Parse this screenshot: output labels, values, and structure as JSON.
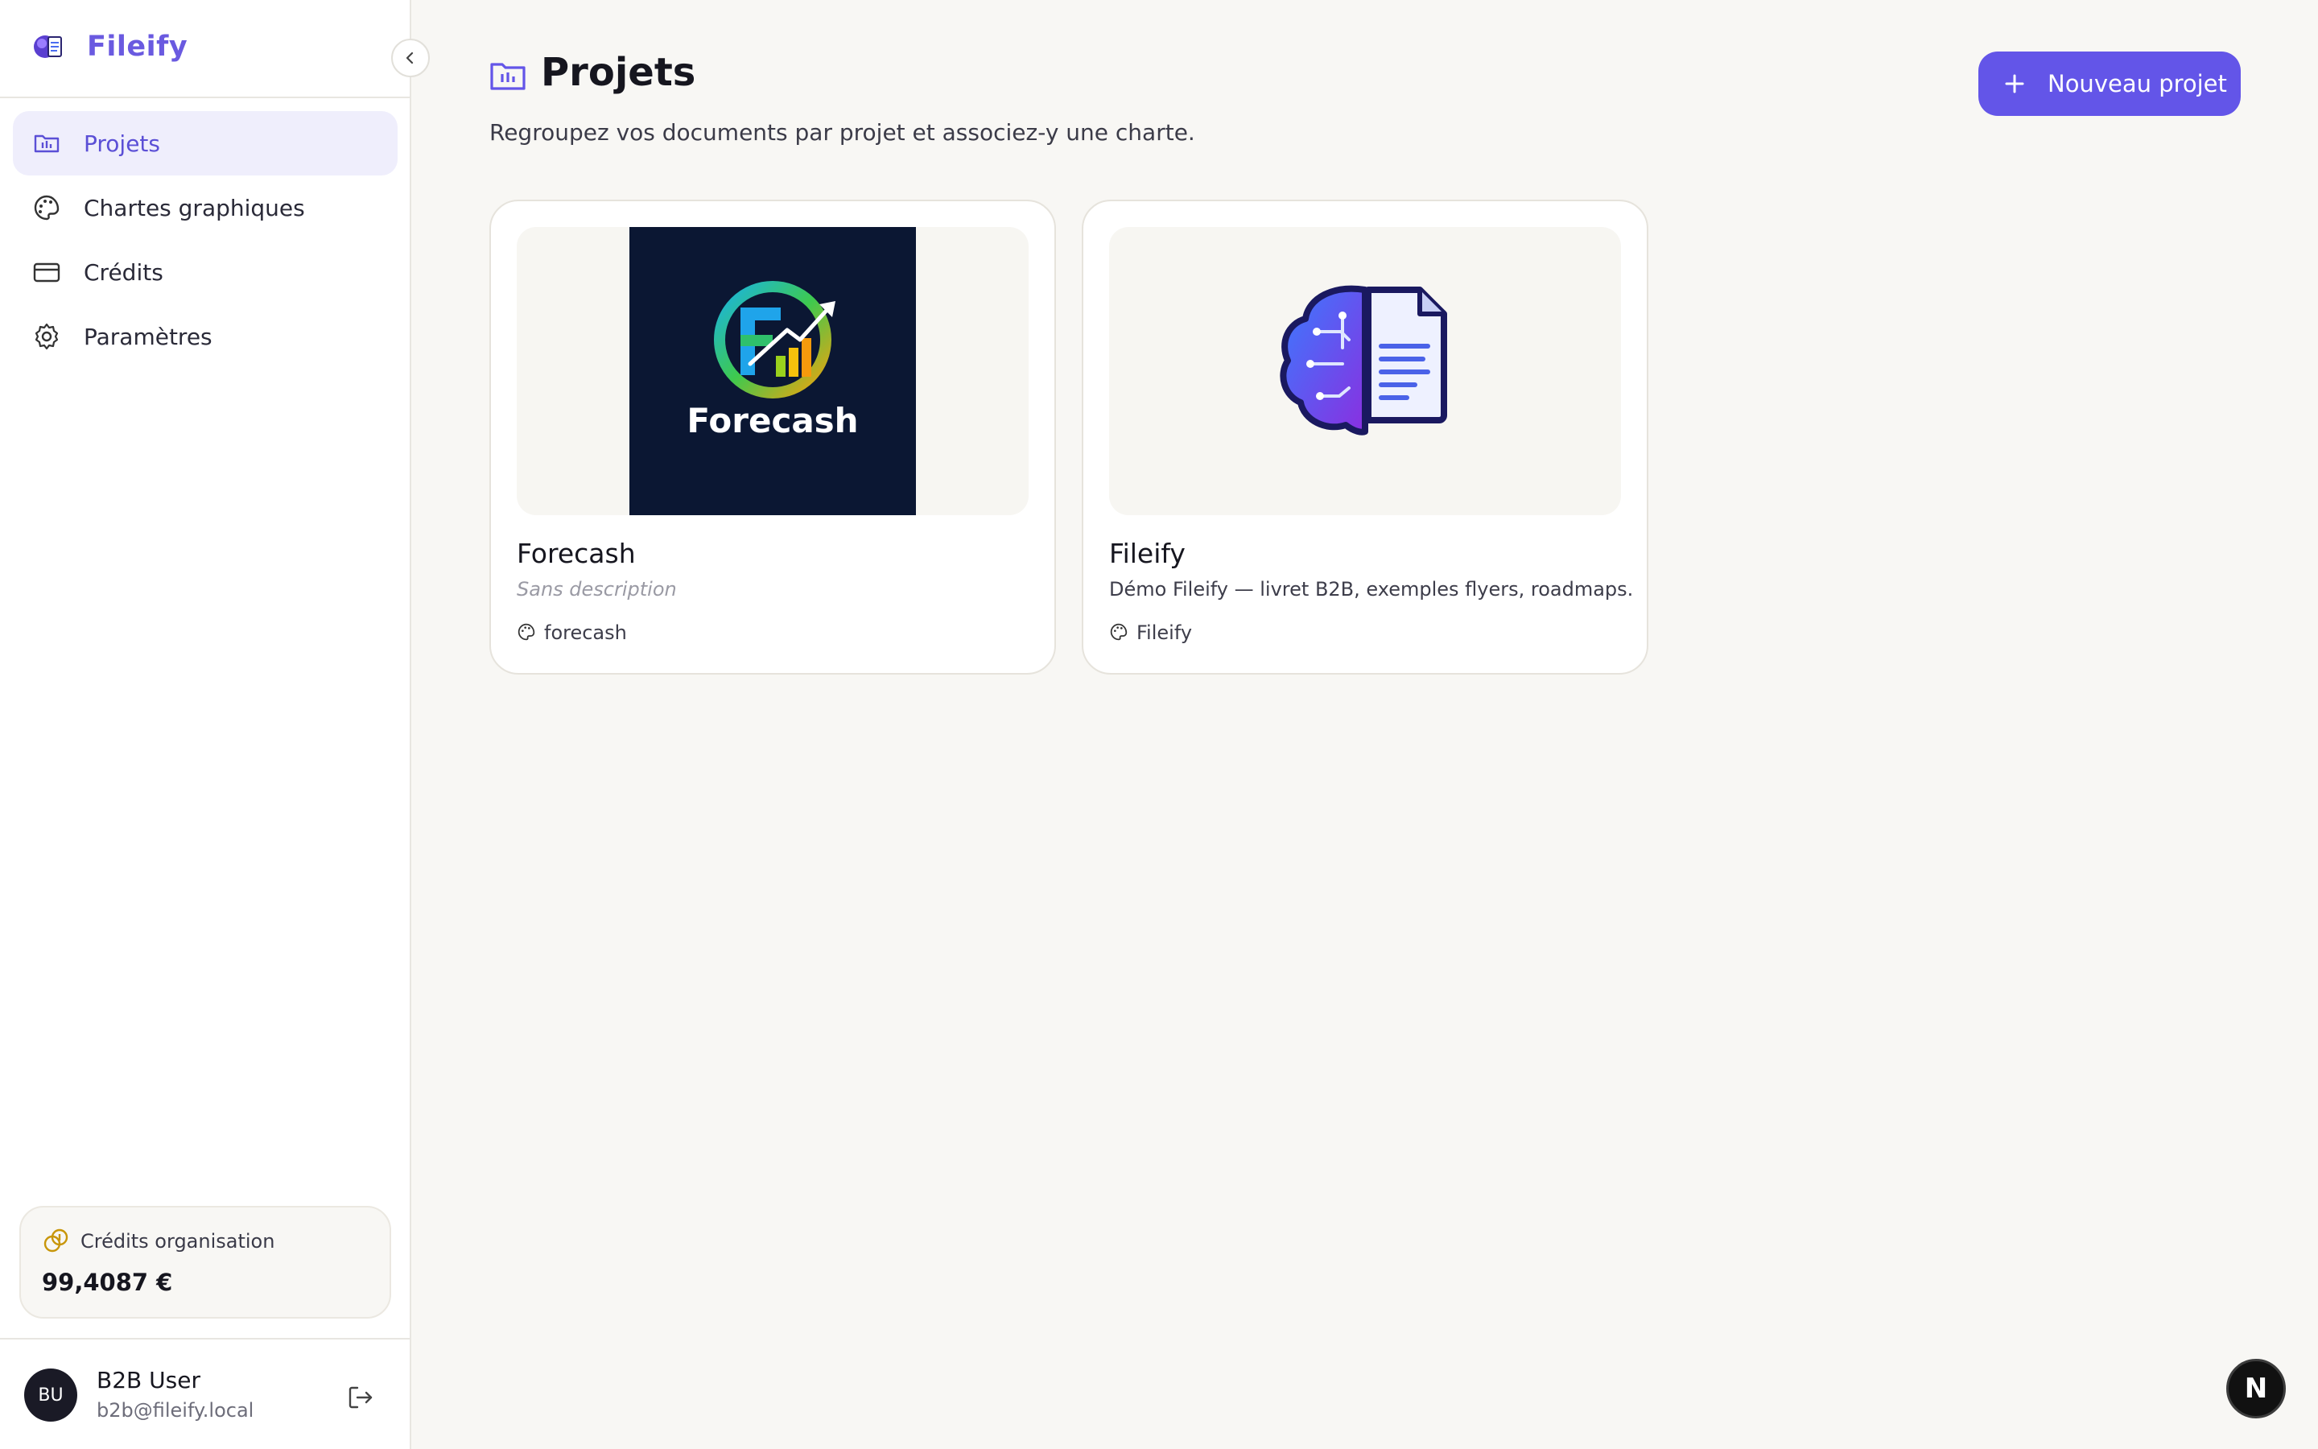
{
  "brand": {
    "name": "Fileify"
  },
  "sidebar": {
    "items": [
      {
        "label": "Projets",
        "icon": "folder-chart-icon",
        "active": true
      },
      {
        "label": "Chartes graphiques",
        "icon": "palette-icon",
        "active": false
      },
      {
        "label": "Crédits",
        "icon": "credit-card-icon",
        "active": false
      },
      {
        "label": "Paramètres",
        "icon": "gear-icon",
        "active": false
      }
    ],
    "credits": {
      "label": "Crédits organisation",
      "value": "99,4087 €"
    },
    "user": {
      "initials": "BU",
      "name": "B2B User",
      "email": "b2b@fileify.local"
    }
  },
  "main": {
    "title": "Projets",
    "subtitle": "Regroupez vos documents par projet et associez-y une charte.",
    "new_button": "Nouveau projet",
    "projects": [
      {
        "name": "Forecash",
        "description": "Sans description",
        "charter": "forecash",
        "logo_text": "Forecash"
      },
      {
        "name": "Fileify",
        "description": "Démo Fileify — livret B2B, exemples flyers, roadmaps.",
        "charter": "Fileify"
      }
    ]
  },
  "dev_badge": "N",
  "colors": {
    "accent": "#6355e8",
    "forecash_bg": "#0b1733",
    "active_nav_bg": "#efeefc"
  }
}
